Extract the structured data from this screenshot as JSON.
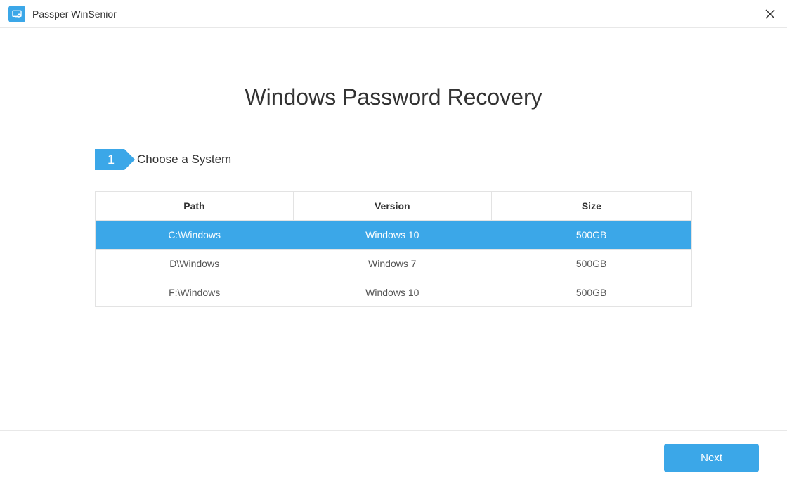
{
  "app": {
    "title": "Passper WinSenior"
  },
  "page": {
    "title": "Windows Password Recovery"
  },
  "step": {
    "number": "1",
    "label": "Choose a System"
  },
  "table": {
    "headers": {
      "path": "Path",
      "version": "Version",
      "size": "Size"
    },
    "rows": [
      {
        "path": "C:\\Windows",
        "version": "Windows 10",
        "size": "500GB",
        "selected": true
      },
      {
        "path": "D\\Windows",
        "version": "Windows 7",
        "size": "500GB",
        "selected": false
      },
      {
        "path": "F:\\Windows",
        "version": "Windows 10",
        "size": "500GB",
        "selected": false
      }
    ]
  },
  "footer": {
    "next_label": "Next"
  }
}
